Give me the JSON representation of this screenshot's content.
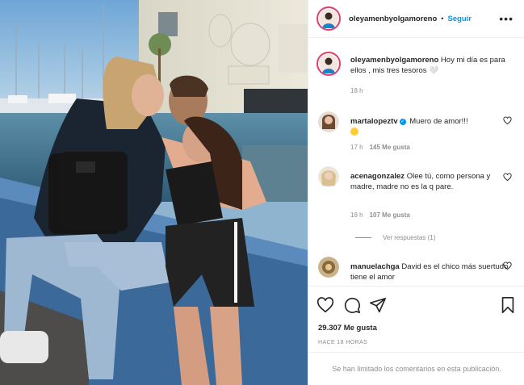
{
  "post": {
    "username": "oleyamenbyolgamoreno",
    "separator": "•",
    "follow_label": "Seguir",
    "more_icon": "more-horizontal-icon",
    "caption_username": "oleyamenbyolgamoreno",
    "caption_text": "Hoy mi día es para ellos , mis tres tesoros 🤍",
    "caption_time": "18 h"
  },
  "comments": [
    {
      "username": "martalopeztv",
      "verified": true,
      "text": "Muero de amor!!!",
      "time": "17 h",
      "likes": "145 Me gusta"
    },
    {
      "username": "acenagonzalez",
      "verified": false,
      "text": "Olee tú, como persona y madre, madre no es la q pare.",
      "time": "18 h",
      "likes": "107 Me gusta"
    },
    {
      "username": "manuelachga",
      "verified": false,
      "text": "David es el chico más suertudo tiene el amor"
    }
  ],
  "view_replies": "Ver respuestas (1)",
  "actions": {
    "like_icon": "heart-icon",
    "comment_icon": "comment-icon",
    "share_icon": "paper-plane-icon",
    "save_icon": "bookmark-icon"
  },
  "likes_count": "29.307 Me gusta",
  "time_ago": "HACE 18 HORAS",
  "limited_comments": "Se han limitado los comentarios en esta publicación.",
  "colors": {
    "accent": "#0095f6",
    "muted": "#8e8e8e",
    "text": "#262626",
    "border": "#efefef"
  }
}
